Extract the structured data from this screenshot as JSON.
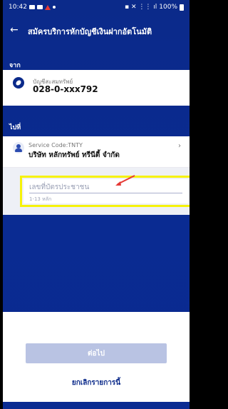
{
  "status_bar": {
    "time": "10:42",
    "battery": "100%"
  },
  "header": {
    "title": "สมัครบริการหักบัญชีเงินฝากอัตโนมัติ"
  },
  "from": {
    "label": "จาก",
    "account_label": "บัญชีสะสมทรัพย์",
    "account_number": "028-0-xxx792"
  },
  "to": {
    "label": "ไปที่",
    "service_code": "Service Code:TNTY",
    "company": "บริษัท หลักทรัพย์ ทรีนีตี้ จำกัด"
  },
  "id_field": {
    "placeholder": "เลขที่บัตรประชาชน",
    "hint": "1-13 หลัก"
  },
  "actions": {
    "next_label": "ต่อไป",
    "cancel_label": "ยกเลิกรายการนี้"
  },
  "colors": {
    "brand": "#0b2a8a",
    "highlight": "#f6f20a",
    "arrow": "#e53935"
  }
}
